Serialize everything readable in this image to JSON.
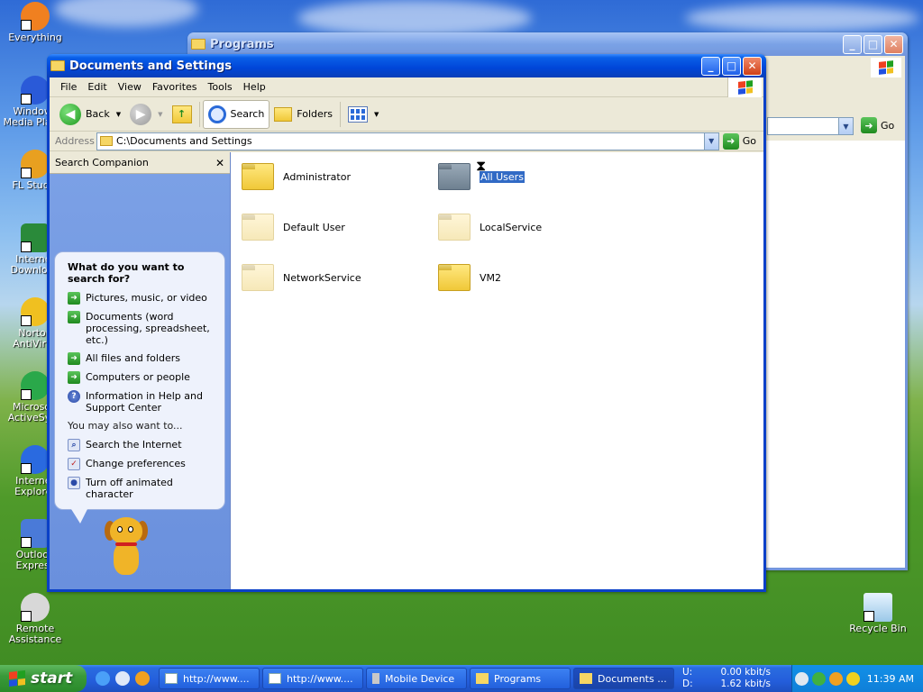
{
  "desktop": {
    "icons": [
      {
        "label": "Everything",
        "color": "#f08020"
      },
      {
        "label": "Windows Media Player",
        "color": "#2a5ad8"
      },
      {
        "label": "FL Studio",
        "color": "#e8a020"
      },
      {
        "label": "Internet Download",
        "color": "#2a8a3a"
      },
      {
        "label": "Norton AntiVirus",
        "color": "#f0c020"
      },
      {
        "label": "Microsoft ActiveSync",
        "color": "#2aa84a"
      },
      {
        "label": "Internet Explorer",
        "color": "#2a6ae0"
      },
      {
        "label": "Outlook Express",
        "color": "#4a7ad8"
      },
      {
        "label": "Remote Assistance",
        "color": "#d8d8d8"
      }
    ],
    "recycle_bin": "Recycle Bin"
  },
  "background_window": {
    "title": "Programs",
    "go_label": "Go"
  },
  "explorer": {
    "title": "Documents and Settings",
    "menu": [
      "File",
      "Edit",
      "View",
      "Favorites",
      "Tools",
      "Help"
    ],
    "toolbar": {
      "back": "Back",
      "search": "Search",
      "folders": "Folders"
    },
    "address": {
      "label": "Address",
      "value": "C:\\Documents and Settings",
      "go": "Go"
    },
    "companion": {
      "title": "Search Companion",
      "question": "What do you want to search for?",
      "options": [
        "Pictures, music, or video",
        "Documents (word processing, spreadsheet, etc.)",
        "All files and folders",
        "Computers or people",
        "Information in Help and Support Center"
      ],
      "also_label": "You may also want to...",
      "also_options": [
        "Search the Internet",
        "Change preferences",
        "Turn off animated character"
      ]
    },
    "folders": [
      {
        "name": "Administrator",
        "style": "normal"
      },
      {
        "name": "All Users",
        "style": "grey",
        "selected": true
      },
      {
        "name": "Default User",
        "style": "faded"
      },
      {
        "name": "LocalService",
        "style": "faded"
      },
      {
        "name": "NetworkService",
        "style": "faded"
      },
      {
        "name": "VM2",
        "style": "normal"
      }
    ]
  },
  "taskbar": {
    "start": "start",
    "tasks": [
      {
        "label": "http://www...."
      },
      {
        "label": "http://www...."
      },
      {
        "label": "Mobile Device"
      },
      {
        "label": "Programs"
      },
      {
        "label": "Documents ...",
        "active": true
      }
    ],
    "netspeed": {
      "u_label": "U:",
      "u_value": "0.00 kbit/s",
      "d_label": "D:",
      "d_value": "1.62 kbit/s"
    },
    "clock": "11:39 AM"
  }
}
